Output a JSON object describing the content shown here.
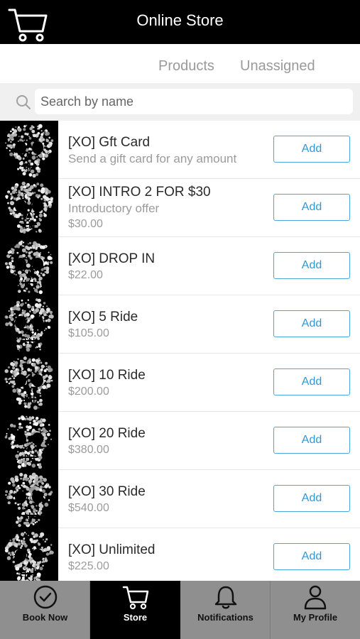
{
  "header": {
    "title": "Online Store",
    "cart_icon": "cart-icon"
  },
  "tabs": [
    {
      "label": "Products"
    },
    {
      "label": "Unassigned"
    }
  ],
  "search": {
    "placeholder": "Search by name",
    "value": ""
  },
  "products": [
    {
      "name": "[XO] Gft Card",
      "subtitle": "Send a gift card for any amount",
      "price": "",
      "button": "Add"
    },
    {
      "name": "[XO] INTRO 2 FOR $30",
      "subtitle": "Introductory offer",
      "price": "$30.00",
      "button": "Add"
    },
    {
      "name": "[XO] DROP IN",
      "subtitle": "",
      "price": "$22.00",
      "button": "Add"
    },
    {
      "name": "[XO] 5 Ride",
      "subtitle": "",
      "price": "$105.00",
      "button": "Add"
    },
    {
      "name": "[XO] 10 Ride",
      "subtitle": "",
      "price": "$200.00",
      "button": "Add"
    },
    {
      "name": "[XO] 20 Ride",
      "subtitle": "",
      "price": "$380.00",
      "button": "Add"
    },
    {
      "name": "[XO] 30 Ride",
      "subtitle": "",
      "price": "$540.00",
      "button": "Add"
    },
    {
      "name": "[XO] Unlimited",
      "subtitle": "",
      "price": "$225.00",
      "button": "Add"
    }
  ],
  "tabbar": [
    {
      "label": "Book Now",
      "icon": "check-circle-icon",
      "active": false
    },
    {
      "label": "Store",
      "icon": "cart-icon",
      "active": true
    },
    {
      "label": "Notifications",
      "icon": "bell-icon",
      "active": false
    },
    {
      "label": "My Profile",
      "icon": "person-icon",
      "active": false
    }
  ],
  "colors": {
    "header_bg": "#000000",
    "accent": "#2f97d8",
    "tabbar_bg": "#8f8f8f"
  }
}
